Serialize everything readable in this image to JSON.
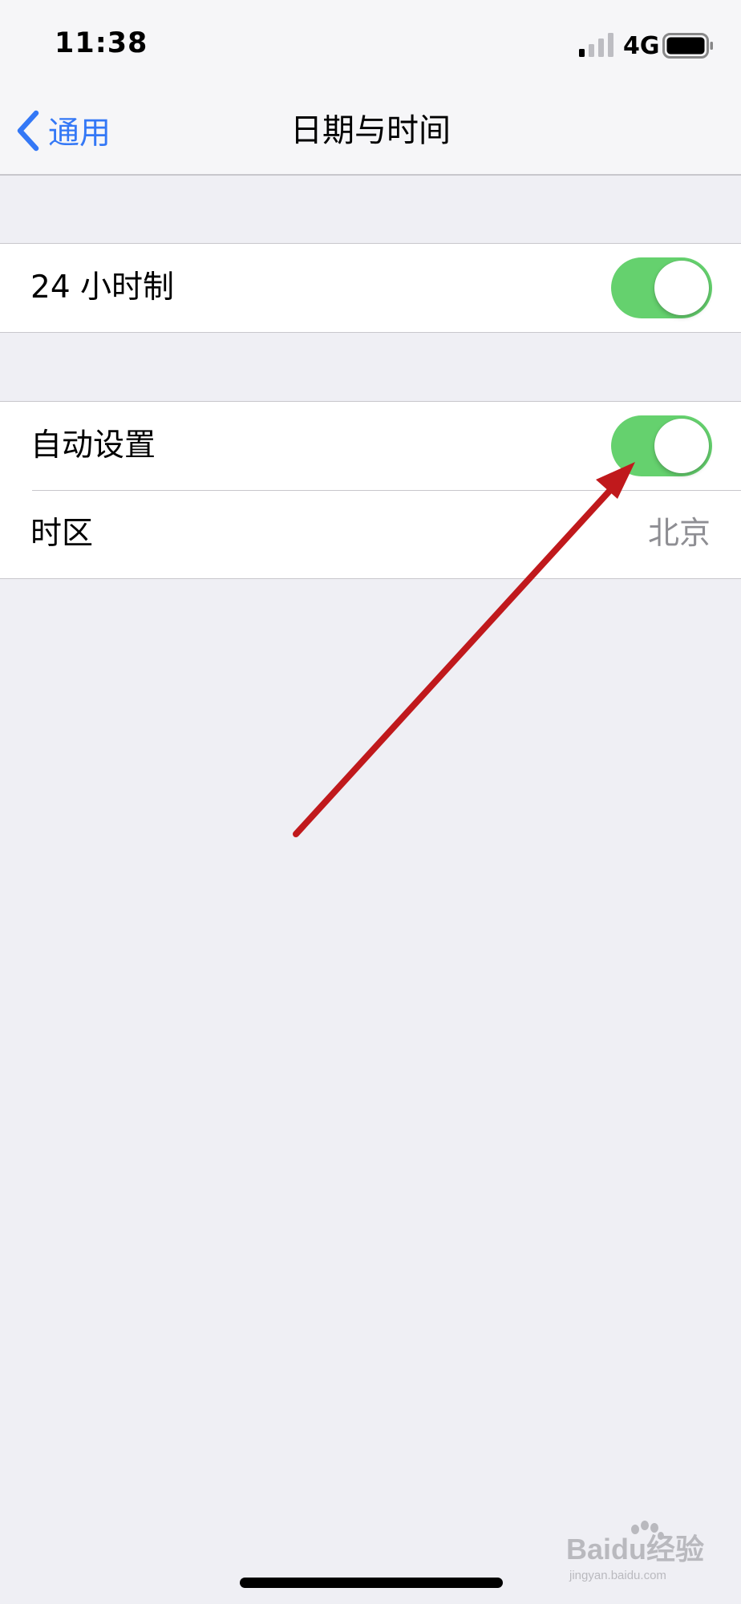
{
  "status_bar": {
    "time": "11:38",
    "network": "4G",
    "signal_bars_active": 1,
    "signal_bars_total": 4,
    "battery_level": 0.9
  },
  "nav": {
    "back_label": "通用",
    "title": "日期与时间"
  },
  "settings": {
    "hour24": {
      "label": "24 小时制",
      "enabled": true
    },
    "auto_set": {
      "label": "自动设置",
      "enabled": true
    },
    "time_zone": {
      "label": "时区",
      "value": "北京"
    }
  },
  "watermark": {
    "text": "Baidu经验",
    "subtext": "jingyan.baidu.com"
  },
  "colors": {
    "accent": "#3478f6",
    "switch_on": "#65d16e",
    "annotation": "#c0191c",
    "secondary_text": "#8e8e93"
  },
  "icons": [
    "chevron-left-icon",
    "signal-icon",
    "battery-icon"
  ]
}
